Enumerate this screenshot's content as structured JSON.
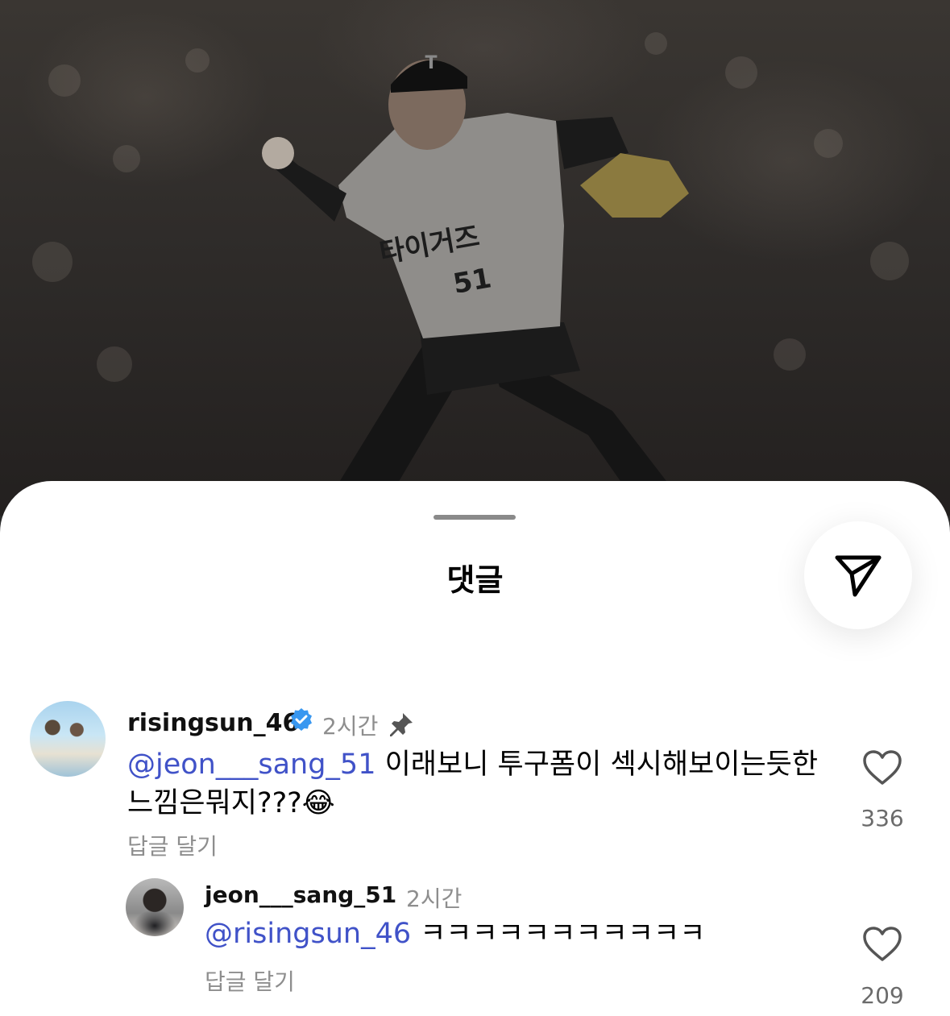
{
  "sheet": {
    "title": "댓글"
  },
  "comments": [
    {
      "username": "risingsun_46",
      "verified": true,
      "time": "2시간",
      "pinned": true,
      "mention": "@jeon___sang_51",
      "text_line1": " 이래보니 투구폼이 섹시해보이는듯한",
      "text_line2": "느낌은뭐지???",
      "emoji": "😂",
      "reply_label": "답글 달기",
      "likes": "336"
    },
    {
      "username": "jeon___sang_51",
      "verified": false,
      "time": "2시간",
      "pinned": false,
      "mention": "@risingsun_46",
      "text_line1": " ㅋㅋㅋㅋㅋㅋㅋㅋㅋㅋㅋ",
      "reply_label": "답글 달기",
      "likes": "209"
    }
  ],
  "background": {
    "jersey_text": "타이거즈",
    "jersey_number": "51",
    "cap_letter": "T"
  },
  "colors": {
    "mention": "#4052c8",
    "verified": "#3897f0",
    "muted": "#8e8e8e"
  },
  "icons": {
    "share": "paper-plane-icon",
    "verified": "verified-badge-icon",
    "pin": "pin-icon",
    "like": "heart-outline-icon"
  }
}
